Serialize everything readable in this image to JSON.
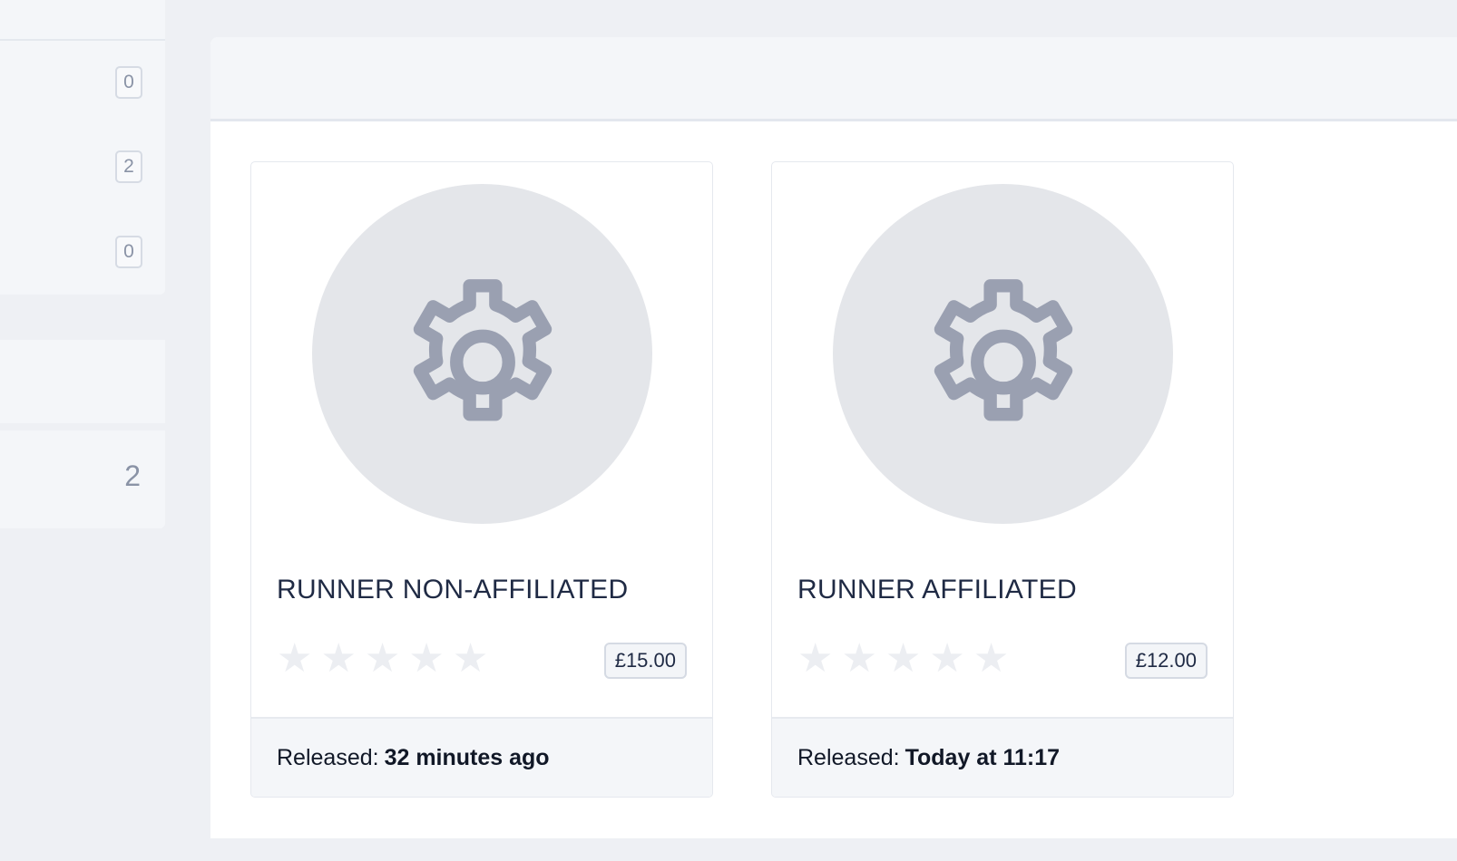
{
  "sidebar": {
    "counts": [
      "0",
      "2",
      "0"
    ],
    "total": "2"
  },
  "products": [
    {
      "icon": "gear-icon",
      "title": "RUNNER NON-AFFILIATED",
      "rating_stars_filled": 0,
      "rating_stars_total": 5,
      "price": "£15.00",
      "released_label": "Released:",
      "released_value": "32 minutes ago"
    },
    {
      "icon": "gear-icon",
      "title": "RUNNER AFFILIATED",
      "rating_stars_filled": 0,
      "rating_stars_total": 5,
      "price": "£12.00",
      "released_label": "Released:",
      "released_value": "Today at 11:17"
    }
  ],
  "colors": {
    "page_bg": "#eef0f4",
    "panel_bg": "#ffffff",
    "icon_circle": "#e4e6ea",
    "icon_stroke": "#9aa0b1",
    "star_empty": "#eceef2"
  }
}
